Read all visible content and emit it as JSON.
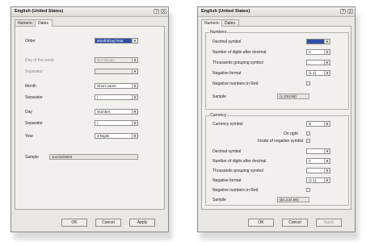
{
  "left_dialog": {
    "title": "English (United States)",
    "tabs": [
      "Numeric",
      "Dates"
    ],
    "fields": [
      {
        "label": "Order",
        "value": "Month/Day/Year"
      },
      {
        "label": "Day of the week",
        "value": "Not shown"
      },
      {
        "label": "Separator",
        "value": ""
      },
      {
        "label": "Month",
        "value": "Short name"
      },
      {
        "label": "Separator",
        "value": "/"
      },
      {
        "label": "Day",
        "value": "Number"
      },
      {
        "label": "Separator",
        "value": "/"
      },
      {
        "label": "Year",
        "value": "4 Digits"
      }
    ],
    "sample_label": "Sample",
    "sample_value": "Jun/16/2004",
    "buttons": {
      "ok": "OK",
      "cancel": "Cancel",
      "apply": "Apply"
    }
  },
  "right_dialog": {
    "title": "English (United States)",
    "tabs": [
      "Numeric",
      "Dates"
    ],
    "numbers": {
      "group_label": "Numbers",
      "decimal_symbol": {
        "label": "Decimal symbol",
        "value": "."
      },
      "digits_after_decimal": {
        "label": "Number of digits after decimal",
        "value": "2"
      },
      "thousands_symbol": {
        "label": "Thousands grouping symbol",
        "value": ","
      },
      "negative_format": {
        "label": "Negative format",
        "value": "(1.1)"
      },
      "negative_red": {
        "label": "Negative numbers in Red"
      },
      "sample_label": "Sample",
      "sample_value": "(1,234.56)"
    },
    "currency": {
      "group_label": "Currency",
      "currency_symbol": {
        "label": "Currency symbol",
        "value": "$"
      },
      "on_right": {
        "label": "On right"
      },
      "inside_negative": {
        "label": "Inside of negative symbol"
      },
      "decimal_symbol": {
        "label": "Decimal symbol",
        "value": "."
      },
      "digits_after_decimal": {
        "label": "Number of digits after decimal",
        "value": "2"
      },
      "thousands_symbol": {
        "label": "Thousands grouping symbol",
        "value": ","
      },
      "negative_format": {
        "label": "Negative format",
        "value": "(1.1)"
      },
      "negative_red": {
        "label": "Negative numbers in Red"
      },
      "sample_label": "Sample",
      "sample_value": "($1,234.56)"
    },
    "buttons": {
      "ok": "OK",
      "cancel": "Cancel",
      "apply": "Apply"
    }
  },
  "icons": {
    "help": "?",
    "close": "X",
    "dropdown": "▼",
    "check": "✓"
  },
  "colors": {
    "selection": "#2f4fa9",
    "dialog_bg": "#e9e7e1"
  }
}
